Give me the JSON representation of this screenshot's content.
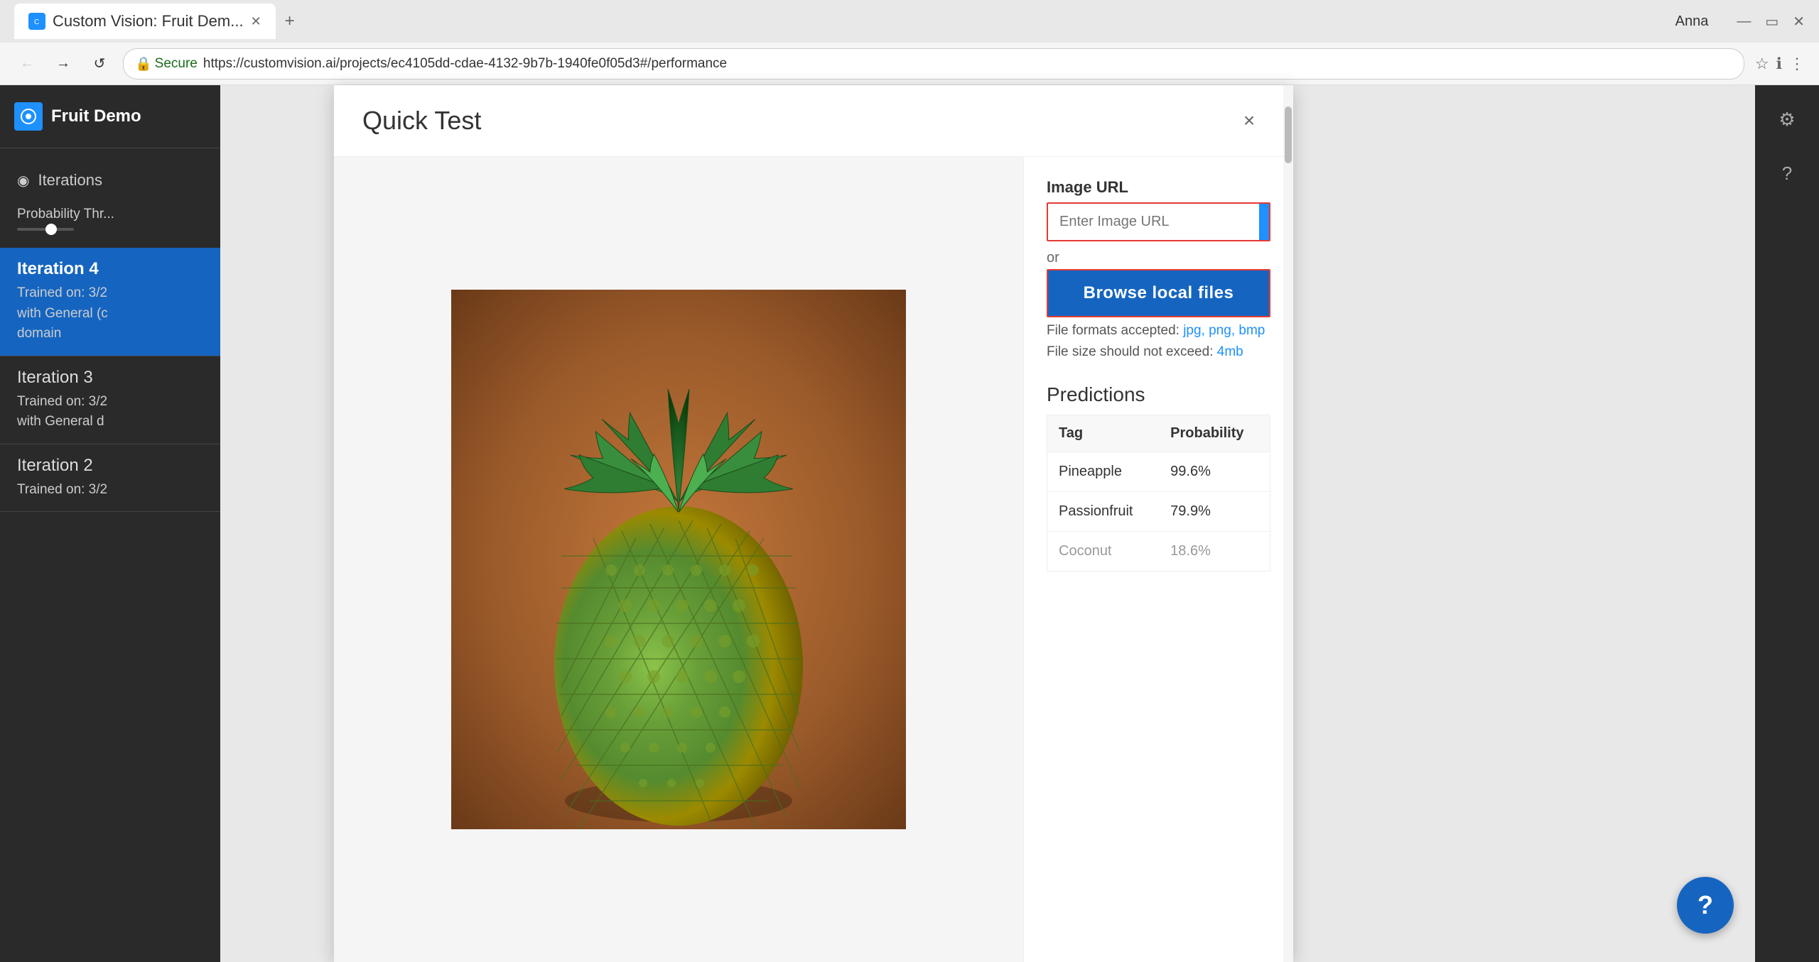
{
  "browser": {
    "tab_title": "Custom Vision: Fruit Dem...",
    "url_secure": "Secure",
    "url": "https://customvision.ai/projects/ec4105dd-cdae-4132-9b7b-1940fe0f05d3#/performance",
    "user": "Anna",
    "new_tab_tooltip": "New tab"
  },
  "sidebar": {
    "logo_alt": "Custom Vision logo",
    "title": "Fruit Demo",
    "nav_items": [
      {
        "label": "Iterations",
        "icon": "⊕"
      }
    ],
    "probability_label": "Probability Thr...",
    "iterations": [
      {
        "id": "iteration4",
        "name": "Iteration 4",
        "detail_line1": "Trained on: 3/2",
        "detail_line2": "with General (c",
        "detail_line3": "domain",
        "active": true
      },
      {
        "id": "iteration3",
        "name": "Iteration 3",
        "detail_line1": "Trained on: 3/2",
        "detail_line2": "with General d",
        "active": false
      },
      {
        "id": "iteration2",
        "name": "Iteration 2",
        "detail_line1": "Trained on: 3/2",
        "active": false
      }
    ]
  },
  "modal": {
    "title": "Quick Test",
    "close_label": "×",
    "image_url_label": "Image URL",
    "url_input_placeholder": "Enter Image URL",
    "or_text": "or",
    "browse_button_label": "Browse local files",
    "file_formats_text": "File formats accepted: ",
    "file_formats_links": "jpg, png, bmp",
    "file_size_text": "File size should not exceed: ",
    "file_size_value": "4mb",
    "predictions_title": "Predictions",
    "table_headers": [
      "Tag",
      "Probability"
    ],
    "predictions": [
      {
        "tag": "Pineapple",
        "probability": "99.6%"
      },
      {
        "tag": "Passionfruit",
        "probability": "79.9%"
      },
      {
        "tag": "Coconut",
        "probability": "18.6%"
      }
    ]
  },
  "help_button": {
    "label": "?"
  },
  "sidebar_right_icons": [
    {
      "name": "settings-icon",
      "symbol": "⚙"
    },
    {
      "name": "help-icon",
      "symbol": "?"
    }
  ]
}
